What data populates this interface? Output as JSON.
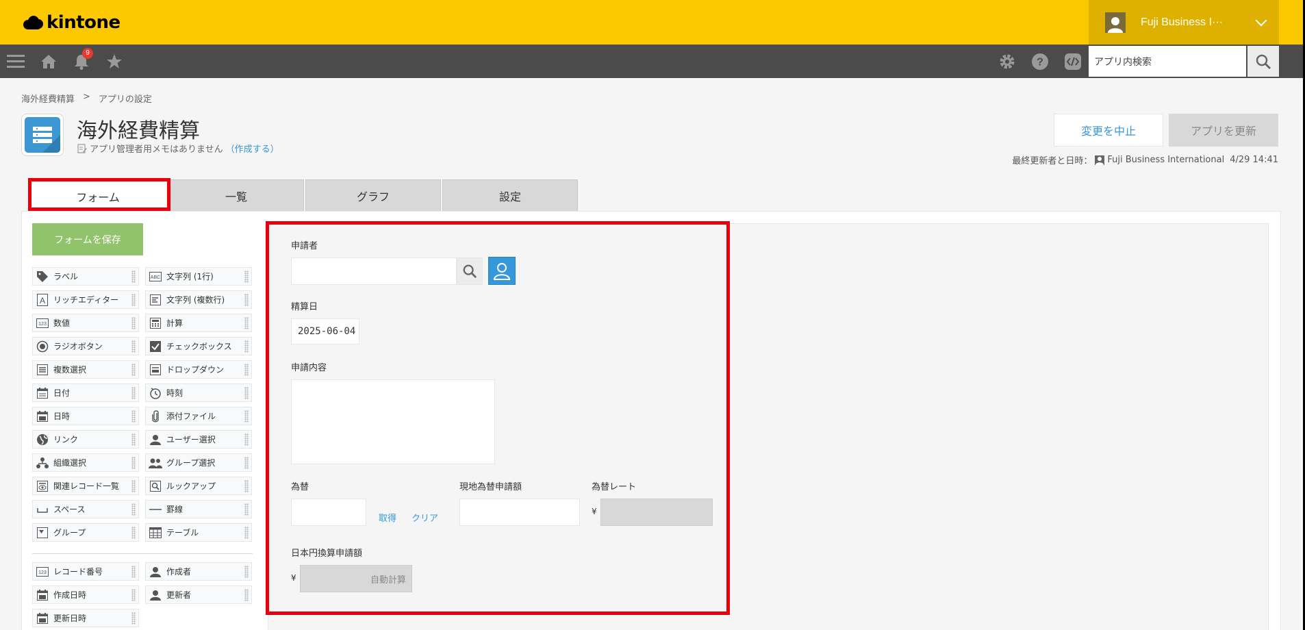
{
  "header": {
    "logo_text": "kintone",
    "user_name": "Fuji Business I···",
    "notification_count": "9",
    "search_placeholder": "アプリ内検索"
  },
  "breadcrumb": [
    "海外経費精算",
    ">",
    "アプリの設定"
  ],
  "app": {
    "title": "海外経費精算",
    "memo_text": "アプリ管理者用メモはありません",
    "memo_link": "（作成する）"
  },
  "actions": {
    "cancel_label": "変更を中止",
    "update_label": "アプリを更新",
    "last_update_label": "最終更新者と日時：",
    "last_update_user": "Fuji Business International",
    "last_update_time": "4/29 14:41"
  },
  "tabs": [
    "フォーム",
    "一覧",
    "グラフ",
    "設定"
  ],
  "palette": {
    "save_label": "フォームを保存",
    "items": [
      {
        "label": "ラベル",
        "icon": "tag-icon"
      },
      {
        "label": "文字列 (1行)",
        "icon": "text-single-icon"
      },
      {
        "label": "リッチエディター",
        "icon": "rich-editor-icon"
      },
      {
        "label": "文字列 (複数行)",
        "icon": "text-multi-icon"
      },
      {
        "label": "数値",
        "icon": "number-icon"
      },
      {
        "label": "計算",
        "icon": "calculator-icon"
      },
      {
        "label": "ラジオボタン",
        "icon": "radio-icon"
      },
      {
        "label": "チェックボックス",
        "icon": "checkbox-icon"
      },
      {
        "label": "複数選択",
        "icon": "multi-select-icon"
      },
      {
        "label": "ドロップダウン",
        "icon": "dropdown-icon"
      },
      {
        "label": "日付",
        "icon": "date-icon"
      },
      {
        "label": "時刻",
        "icon": "clock-icon"
      },
      {
        "label": "日時",
        "icon": "datetime-icon"
      },
      {
        "label": "添付ファイル",
        "icon": "paperclip-icon"
      },
      {
        "label": "リンク",
        "icon": "globe-icon"
      },
      {
        "label": "ユーザー選択",
        "icon": "user-icon"
      },
      {
        "label": "組織選択",
        "icon": "org-icon"
      },
      {
        "label": "グループ選択",
        "icon": "group-icon"
      },
      {
        "label": "関連レコード一覧",
        "icon": "related-records-icon"
      },
      {
        "label": "ルックアップ",
        "icon": "lookup-icon"
      },
      {
        "label": "スペース",
        "icon": "space-icon"
      },
      {
        "label": "罫線",
        "icon": "line-icon"
      },
      {
        "label": "グループ",
        "icon": "group-field-icon"
      },
      {
        "label": "テーブル",
        "icon": "table-icon"
      }
    ],
    "system_items": [
      {
        "label": "レコード番号",
        "icon": "record-number-icon"
      },
      {
        "label": "作成者",
        "icon": "creator-icon"
      },
      {
        "label": "作成日時",
        "icon": "created-date-icon"
      },
      {
        "label": "更新者",
        "icon": "modifier-icon"
      },
      {
        "label": "更新日時",
        "icon": "updated-date-icon"
      }
    ]
  },
  "form": {
    "applicant_label": "申請者",
    "date_label": "精算日",
    "date_value": "2025-06-04",
    "content_label": "申請内容",
    "exchange_label": "為替",
    "get_link": "取得",
    "clear_link": "クリア",
    "local_amount_label": "現地為替申請額",
    "rate_label": "為替レート",
    "yen_symbol": "¥",
    "jpy_amount_label": "日本円換算申請額",
    "auto_calc": "自動計算"
  },
  "colors": {
    "header_bg": "#fcc800",
    "toolbar_bg": "#4b4b4b",
    "accent_blue": "#3498db",
    "save_green": "#91c36c",
    "highlight_red": "#e8000d"
  }
}
